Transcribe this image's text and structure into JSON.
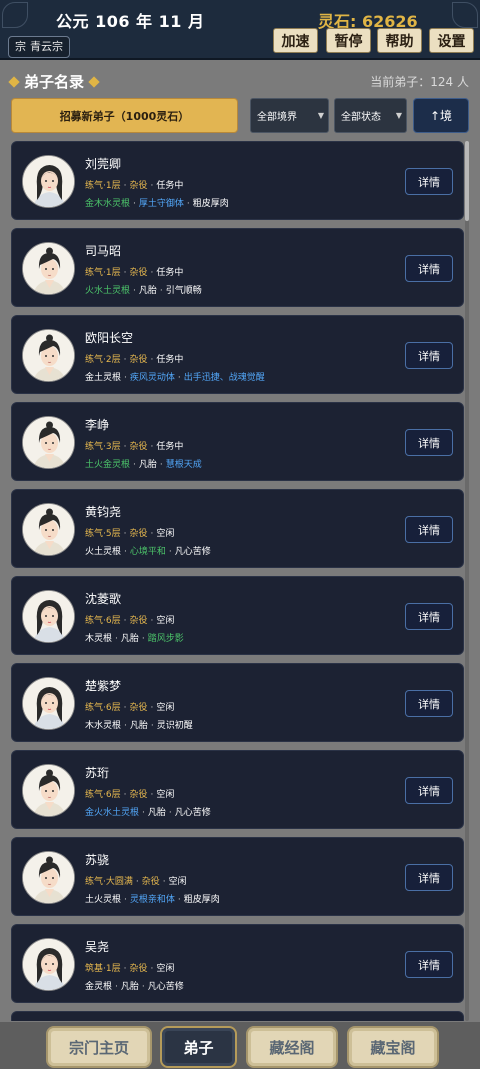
{
  "header": {
    "date": "公元 106 年 11 月",
    "spirit_stones": "灵石: 62626",
    "sect_icon": "宗",
    "sect_name": "青云宗",
    "buttons": [
      "加速",
      "暂停",
      "帮助",
      "设置"
    ]
  },
  "section": {
    "title": "弟子名录",
    "count": "当前弟子：124 人"
  },
  "filters": {
    "recruit_label": "招募新弟子（1000灵石）",
    "realm_select": "全部境界",
    "status_select": "全部状态",
    "sort_label": "↑境"
  },
  "disciples": [
    {
      "name": "刘莞卿",
      "realm": "练气·1层",
      "role": "杂役",
      "status": "任务中",
      "root": "金木水灵根",
      "root_color": "green",
      "physique": "厚土守御体",
      "physique_color": "blue",
      "trait": "粗皮厚肉",
      "trait_color": "white",
      "avatar": "female-avatar"
    },
    {
      "name": "司马昭",
      "realm": "练气·1层",
      "role": "杂役",
      "status": "任务中",
      "root": "火水土灵根",
      "root_color": "green",
      "physique": "凡胎",
      "physique_color": "white",
      "trait": "引气顺畅",
      "trait_color": "white",
      "avatar": "male-avatar"
    },
    {
      "name": "欧阳长空",
      "realm": "练气·2层",
      "role": "杂役",
      "status": "任务中",
      "root": "金土灵根",
      "root_color": "white",
      "physique": "疾风灵动体",
      "physique_color": "blue",
      "trait": "出手迅捷、战魂觉醒",
      "trait_color": "blue",
      "avatar": "male-avatar"
    },
    {
      "name": "李峥",
      "realm": "练气·3层",
      "role": "杂役",
      "status": "任务中",
      "root": "土火金灵根",
      "root_color": "green",
      "physique": "凡胎",
      "physique_color": "white",
      "trait": "慧根天成",
      "trait_color": "blue",
      "avatar": "male-avatar"
    },
    {
      "name": "黄钧尧",
      "realm": "练气·5层",
      "role": "杂役",
      "status": "空闲",
      "root": "火土灵根",
      "root_color": "white",
      "physique": "心境平和",
      "physique_color": "green",
      "trait": "凡心苦修",
      "trait_color": "white",
      "avatar": "male-avatar"
    },
    {
      "name": "沈菱歌",
      "realm": "练气·6层",
      "role": "杂役",
      "status": "空闲",
      "root": "木灵根",
      "root_color": "white",
      "physique": "凡胎",
      "physique_color": "white",
      "trait": "踏风步影",
      "trait_color": "green",
      "avatar": "female-avatar"
    },
    {
      "name": "楚紫梦",
      "realm": "练气·6层",
      "role": "杂役",
      "status": "空闲",
      "root": "木水灵根",
      "root_color": "white",
      "physique": "凡胎",
      "physique_color": "white",
      "trait": "灵识初醒",
      "trait_color": "white",
      "avatar": "female-avatar"
    },
    {
      "name": "苏珩",
      "realm": "练气·6层",
      "role": "杂役",
      "status": "空闲",
      "root": "金火水土灵根",
      "root_color": "blue",
      "physique": "凡胎",
      "physique_color": "white",
      "trait": "凡心苦修",
      "trait_color": "white",
      "avatar": "male-avatar"
    },
    {
      "name": "苏骁",
      "realm": "练气·大圆满",
      "role": "杂役",
      "status": "空闲",
      "root": "土火灵根",
      "root_color": "white",
      "physique": "灵根亲和体",
      "physique_color": "blue",
      "trait": "粗皮厚肉",
      "trait_color": "white",
      "avatar": "male-avatar"
    },
    {
      "name": "吴尧",
      "realm": "筑基·1层",
      "role": "杂役",
      "status": "空闲",
      "root": "金灵根",
      "root_color": "white",
      "physique": "凡胎",
      "physique_color": "white",
      "trait": "凡心苦修",
      "trait_color": "white",
      "avatar": "female-avatar"
    }
  ],
  "detail_label": "详情",
  "nav": {
    "items": [
      "宗门主页",
      "弟子",
      "藏经阁",
      "藏宝阁"
    ],
    "active": "弟子"
  },
  "colors": {
    "gold": "#e6b84f",
    "green": "#4cc46a",
    "blue": "#52a6f7",
    "card_bg": "#1c2233",
    "header_bg": "#1d2b3d"
  }
}
